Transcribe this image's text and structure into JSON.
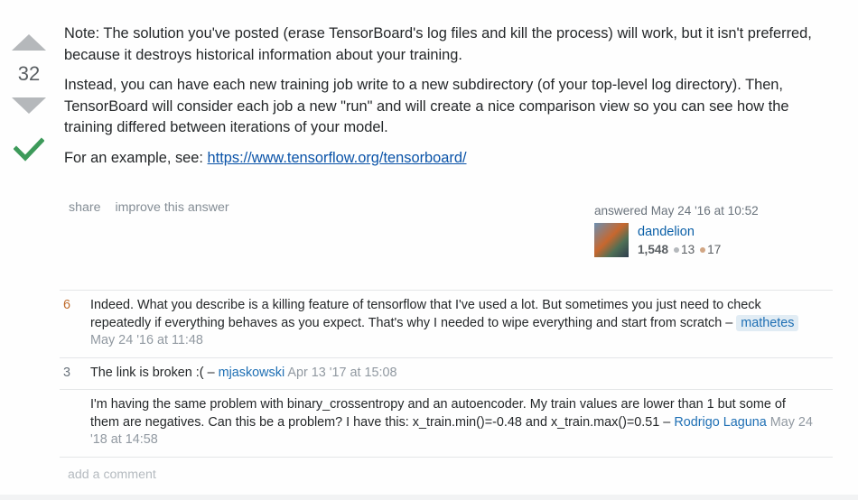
{
  "vote": {
    "count": "32"
  },
  "answer": {
    "paragraph1": "Note: The solution you've posted (erase TensorBoard's log files and kill the process) will work, but it isn't preferred, because it destroys historical information about your training.",
    "paragraph2": "Instead, you can have each new training job write to a new subdirectory (of your top-level log directory). Then, TensorBoard will consider each job a new \"run\" and will create a nice comparison view so you can see how the training differed between iterations of your model.",
    "example_prefix": "For an example, see: ",
    "example_link": "https://www.tensorflow.org/tensorboard/"
  },
  "post_menu": {
    "share": "share",
    "improve": "improve this answer"
  },
  "user_card": {
    "action": "answered May 24 '16 at 10:52",
    "name": "dandelion",
    "reputation": "1,548",
    "silver": "13",
    "bronze": "17"
  },
  "comments": [
    {
      "score": "6",
      "text": "Indeed. What you describe is a killing feature of tensorflow that I've used a lot. But sometimes you just need to check repeatedly if everything behaves as you expect. That's why I needed to wipe everything and start from scratch – ",
      "user": "mathetes",
      "date": " May 24 '16 at 11:48"
    },
    {
      "score": "3",
      "text": "The link is broken :( – ",
      "user": "mjaskowski",
      "date": " Apr 13 '17 at 15:08"
    },
    {
      "score": "",
      "text": "I'm having the same problem with binary_crossentropy and an autoencoder. My train values are lower than 1 but some of them are negatives. Can this be a problem? I have this: x_train.min()=-0.48 and x_train.max()=0.51 – ",
      "user": "Rodrigo Laguna",
      "date": " May 24 '18 at 14:58"
    }
  ],
  "add_comment": "add a comment",
  "colors": {
    "accent_link": "#0a53a8",
    "accepted_check": "#3d9a5a",
    "vote_arrow": "#b5b8bb",
    "comment_score": "#be6a2a"
  },
  "icons": {
    "upvote": "upvote-arrow-icon",
    "downvote": "downvote-arrow-icon",
    "accepted": "checkmark-icon"
  }
}
